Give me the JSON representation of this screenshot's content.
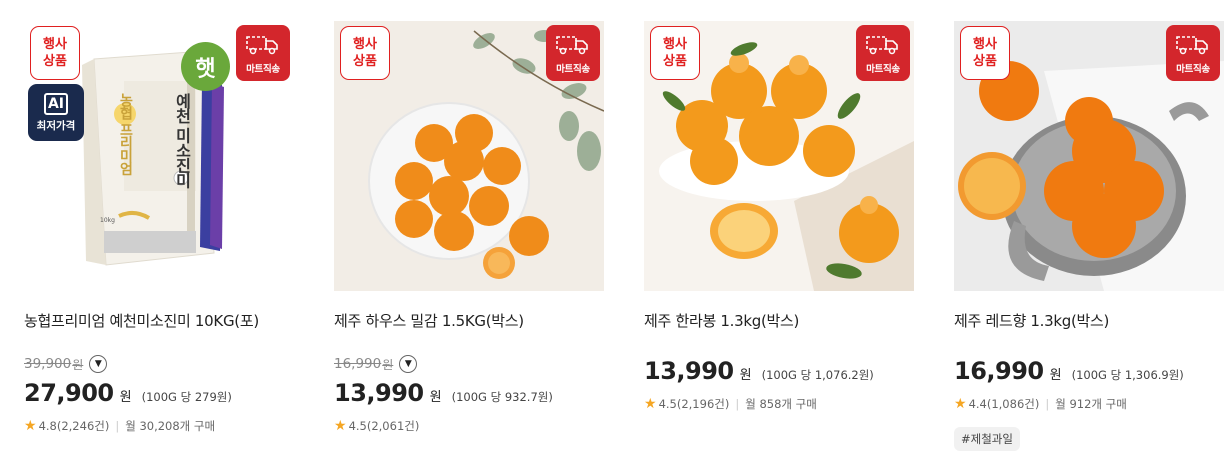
{
  "products": [
    {
      "name": "농협프리미엄 예천미소진미 10KG(포)",
      "event_badge": [
        "행사",
        "상품"
      ],
      "mart_badge": "마트직송",
      "ai_badge": {
        "title": "AI",
        "label": "최저가격"
      },
      "new_badge": "햇",
      "package_text": {
        "brand": "농협 프리미엄",
        "product": "예천 미소진미",
        "weight": "10kg"
      },
      "original_price": "39,900",
      "original_won": "원",
      "price": "27,900",
      "won": "원",
      "unit_price": "(100G 당 279원)",
      "rating": "4.8(2,246건)",
      "monthly": "월 30,208개 구매"
    },
    {
      "name": "제주 하우스 밀감 1.5KG(박스)",
      "event_badge": [
        "행사",
        "상품"
      ],
      "mart_badge": "마트직송",
      "original_price": "16,990",
      "original_won": "원",
      "price": "13,990",
      "won": "원",
      "unit_price": "(100G 당 932.7원)",
      "rating": "4.5(2,061건)"
    },
    {
      "name": "제주 한라봉 1.3kg(박스)",
      "event_badge": [
        "행사",
        "상품"
      ],
      "mart_badge": "마트직송",
      "price": "13,990",
      "won": "원",
      "unit_price": "(100G 당 1,076.2원)",
      "rating": "4.5(2,196건)",
      "monthly": "월 858개 구매"
    },
    {
      "name": "제주 레드향 1.3kg(박스)",
      "event_badge": [
        "행사",
        "상품"
      ],
      "mart_badge": "마트직송",
      "price": "16,990",
      "won": "원",
      "unit_price": "(100G 당 1,306.9원)",
      "rating": "4.4(1,086건)",
      "monthly": "월 912개 구매",
      "tag": "#제철과일"
    }
  ],
  "icons": {
    "star": "star-icon",
    "truck": "truck-icon",
    "info": "chevron-down-icon"
  },
  "colors": {
    "event_red": "#e02020",
    "mart_red": "#d3262c",
    "ai_navy": "#1a2a4d",
    "new_green": "#6aa83b",
    "star_yellow": "#f5a623"
  }
}
